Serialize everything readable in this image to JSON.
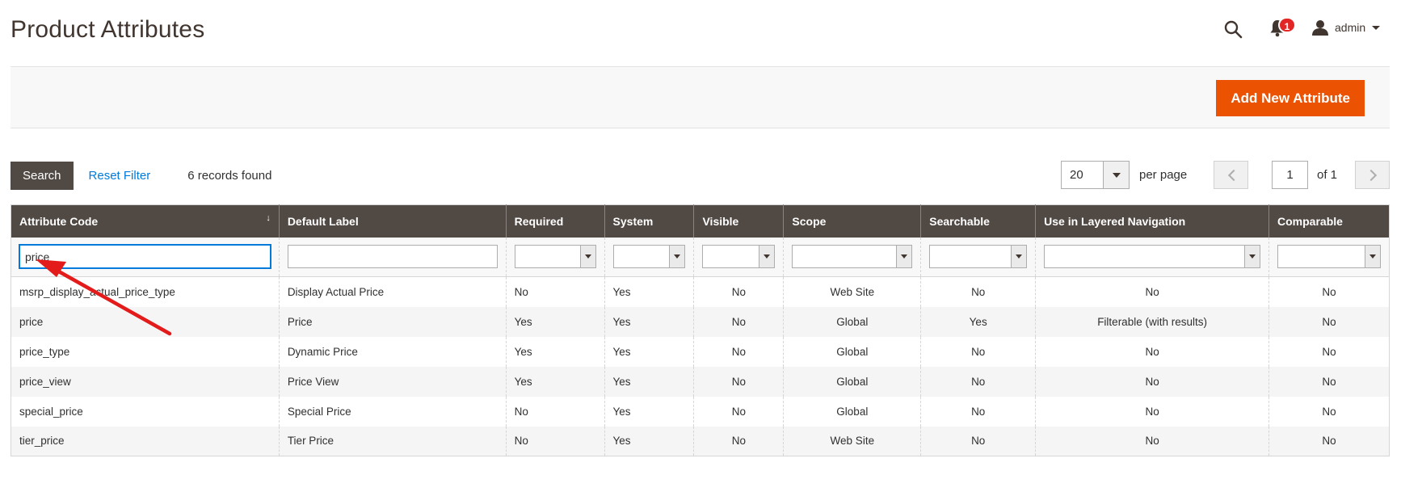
{
  "header": {
    "title": "Product Attributes",
    "notification_count": "1",
    "user_name": "admin"
  },
  "action_bar": {
    "add_button_label": "Add New Attribute"
  },
  "grid_toolbar": {
    "search_label": "Search",
    "reset_label": "Reset Filter",
    "records_text": "6 records found",
    "per_page_value": "20",
    "per_page_label": "per page",
    "current_page": "1",
    "page_of": "of 1"
  },
  "table": {
    "columns": [
      "Attribute Code",
      "Default Label",
      "Required",
      "System",
      "Visible",
      "Scope",
      "Searchable",
      "Use in Layered Navigation",
      "Comparable"
    ],
    "filter_attribute_code": "price",
    "rows": [
      {
        "code": "msrp_display_actual_price_type",
        "label": "Display Actual Price",
        "required": "No",
        "system": "Yes",
        "visible": "No",
        "scope": "Web Site",
        "searchable": "No",
        "layered": "No",
        "comparable": "No"
      },
      {
        "code": "price",
        "label": "Price",
        "required": "Yes",
        "system": "Yes",
        "visible": "No",
        "scope": "Global",
        "searchable": "Yes",
        "layered": "Filterable (with results)",
        "comparable": "No"
      },
      {
        "code": "price_type",
        "label": "Dynamic Price",
        "required": "Yes",
        "system": "Yes",
        "visible": "No",
        "scope": "Global",
        "searchable": "No",
        "layered": "No",
        "comparable": "No"
      },
      {
        "code": "price_view",
        "label": "Price View",
        "required": "Yes",
        "system": "Yes",
        "visible": "No",
        "scope": "Global",
        "searchable": "No",
        "layered": "No",
        "comparable": "No"
      },
      {
        "code": "special_price",
        "label": "Special Price",
        "required": "No",
        "system": "Yes",
        "visible": "No",
        "scope": "Global",
        "searchable": "No",
        "layered": "No",
        "comparable": "No"
      },
      {
        "code": "tier_price",
        "label": "Tier Price",
        "required": "No",
        "system": "Yes",
        "visible": "No",
        "scope": "Web Site",
        "searchable": "No",
        "layered": "No",
        "comparable": "No"
      }
    ]
  },
  "colors": {
    "accent": "#eb5202",
    "header_bg": "#514943",
    "link": "#007bdb",
    "badge": "#e22626",
    "annotation_arrow": "#e31b1b"
  },
  "icons": [
    "search-icon",
    "bell-icon",
    "user-icon",
    "sort-arrow-icon",
    "chevron-left-icon",
    "chevron-right-icon",
    "annotation-arrow"
  ]
}
